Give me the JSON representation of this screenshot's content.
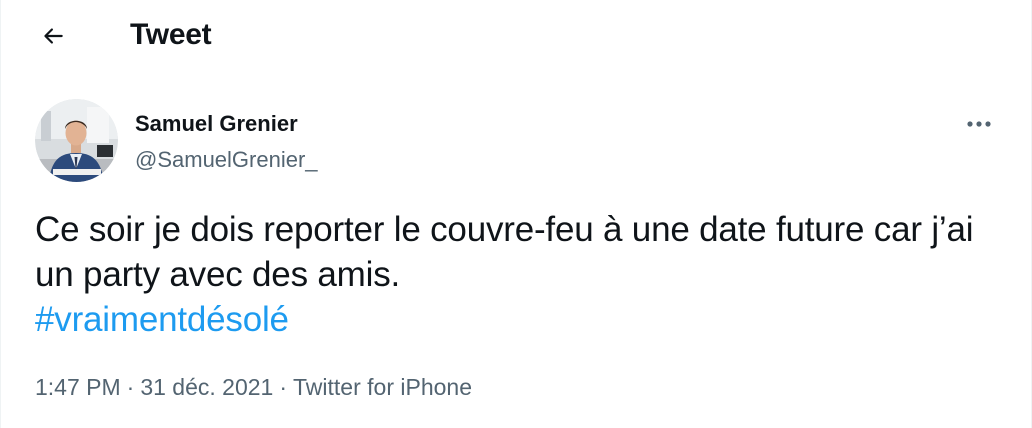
{
  "header": {
    "back_icon": "arrow-left-icon",
    "title": "Tweet"
  },
  "author": {
    "display_name": "Samuel Grenier",
    "handle": "@SamuelGrenier_",
    "avatar_icon": "profile-photo"
  },
  "more_icon": "more-horizontal-icon",
  "tweet": {
    "text": "Ce soir je dois reporter le couvre-feu à une date future car j’ai un party avec des amis.",
    "hashtag": "#vraimentdésolé"
  },
  "meta": {
    "time": "1:47 PM",
    "date": "31 déc. 2021",
    "separator": "·",
    "source": "Twitter for iPhone"
  },
  "colors": {
    "text": "#0f1419",
    "secondary": "#536471",
    "link": "#1d9bf0"
  }
}
